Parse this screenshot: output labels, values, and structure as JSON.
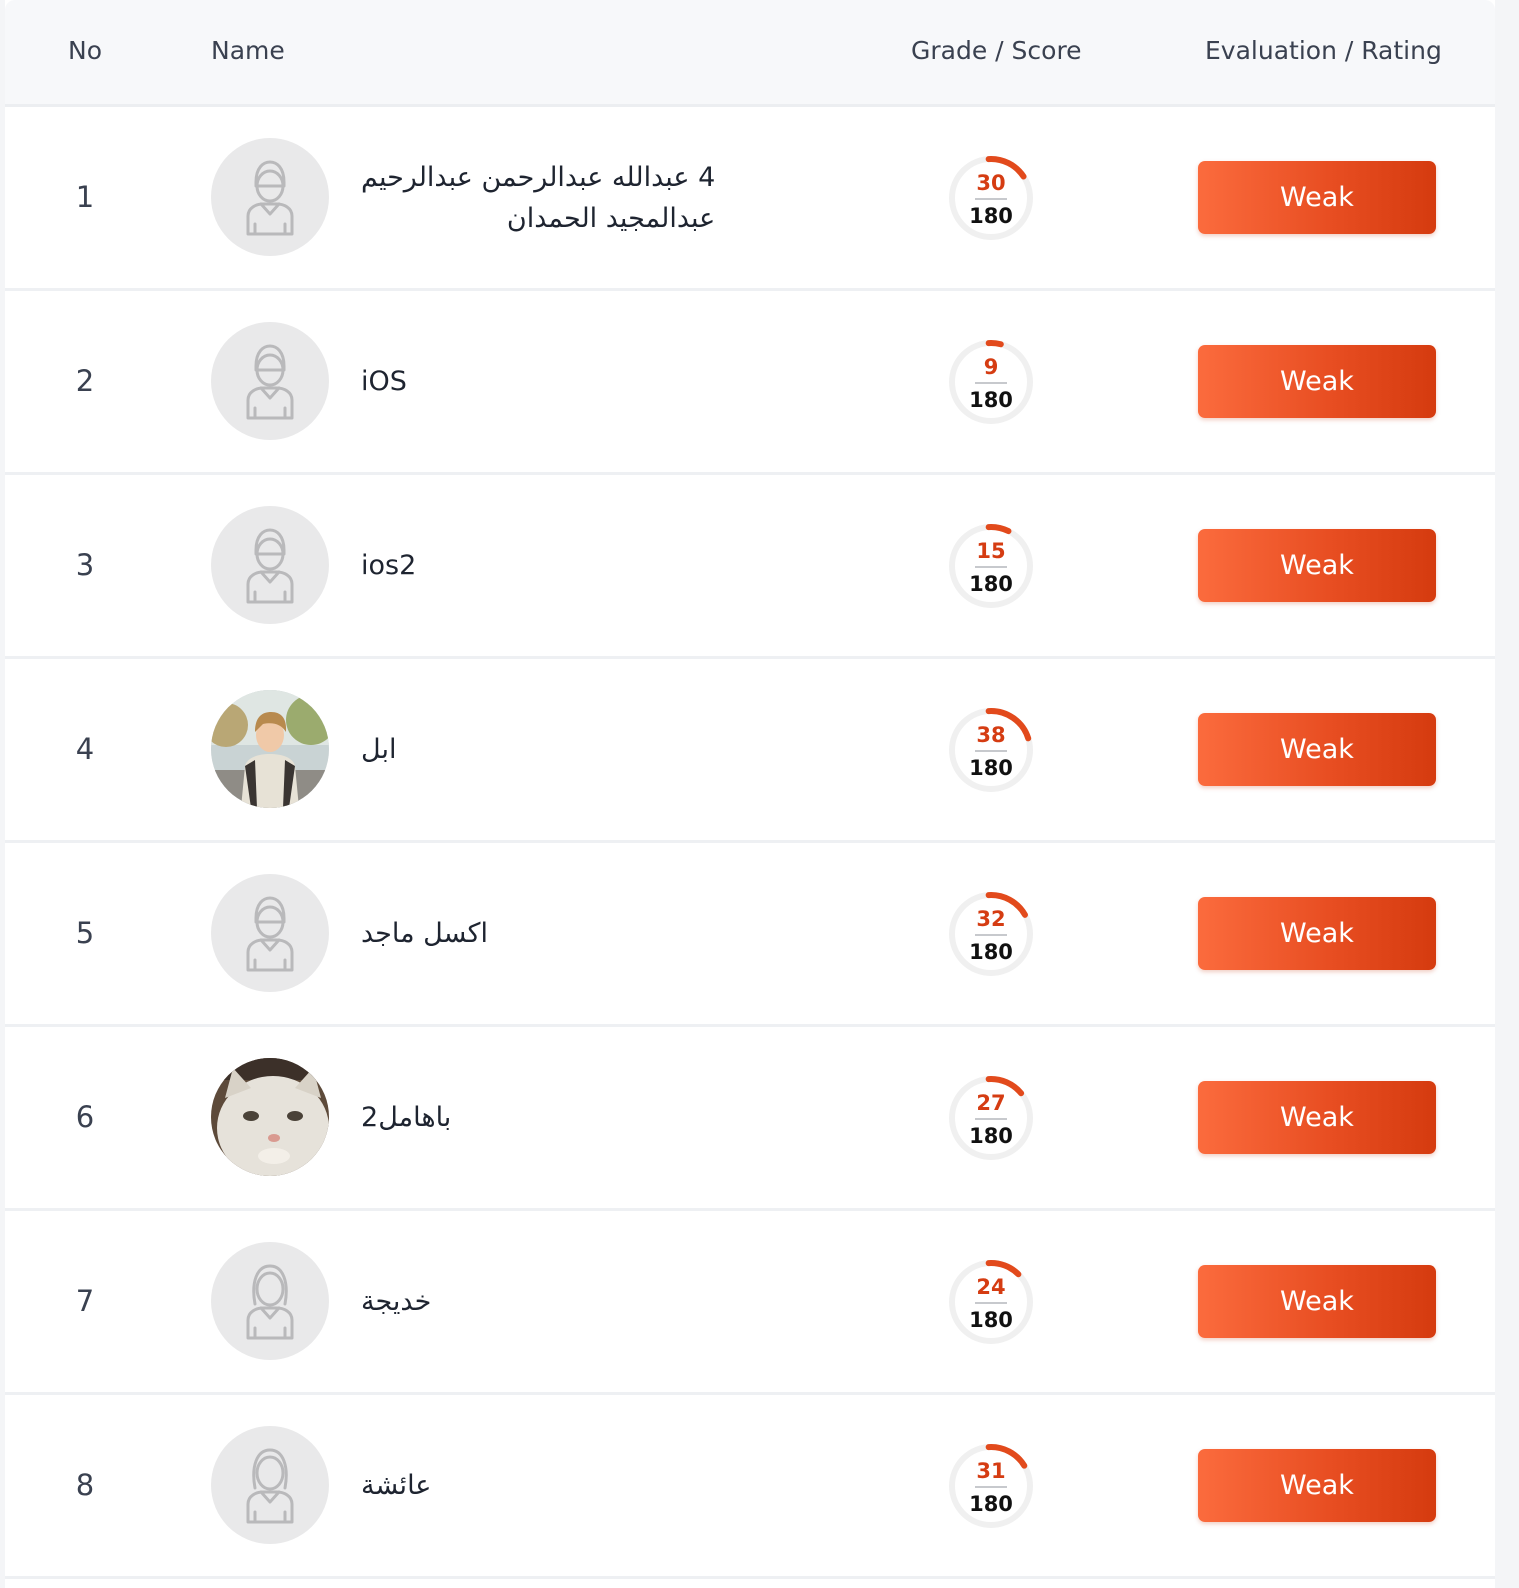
{
  "header": {
    "no": "No",
    "name": "Name",
    "grade": "Grade / Score",
    "evaluation": "Evaluation / Rating"
  },
  "colors": {
    "accent": "#e24a1c",
    "ring_track": "#f0f0f0",
    "avatar_bg": "#e9e9ea"
  },
  "rows": [
    {
      "no": "1",
      "name_lines": [
        "4 عبدالله عبدالرحمن عبدالرحيم",
        "عبدالمجيد الحمدان"
      ],
      "avatar": "male-placeholder-icon",
      "score": 30,
      "total": 180,
      "score_label": "30",
      "total_label": "180",
      "rating": "Weak"
    },
    {
      "no": "2",
      "name_lines": [
        "iOS"
      ],
      "avatar": "male-placeholder-icon",
      "score": 9,
      "total": 180,
      "score_label": "9",
      "total_label": "180",
      "rating": "Weak"
    },
    {
      "no": "3",
      "name_lines": [
        "ios2"
      ],
      "avatar": "male-placeholder-icon",
      "score": 15,
      "total": 180,
      "score_label": "15",
      "total_label": "180",
      "rating": "Weak"
    },
    {
      "no": "4",
      "name_lines": [
        "ابل"
      ],
      "avatar": "photo-boy",
      "score": 38,
      "total": 180,
      "score_label": "38",
      "total_label": "180",
      "rating": "Weak"
    },
    {
      "no": "5",
      "name_lines": [
        "اكسل ماجد"
      ],
      "avatar": "male-placeholder-icon",
      "score": 32,
      "total": 180,
      "score_label": "32",
      "total_label": "180",
      "rating": "Weak"
    },
    {
      "no": "6",
      "name_lines": [
        "باهامل2"
      ],
      "avatar": "photo-cat",
      "score": 27,
      "total": 180,
      "score_label": "27",
      "total_label": "180",
      "rating": "Weak"
    },
    {
      "no": "7",
      "name_lines": [
        "خديجة"
      ],
      "avatar": "female-placeholder-icon",
      "score": 24,
      "total": 180,
      "score_label": "24",
      "total_label": "180",
      "rating": "Weak"
    },
    {
      "no": "8",
      "name_lines": [
        "عائشة"
      ],
      "avatar": "female-placeholder-icon",
      "score": 31,
      "total": 180,
      "score_label": "31",
      "total_label": "180",
      "rating": "Weak"
    }
  ]
}
